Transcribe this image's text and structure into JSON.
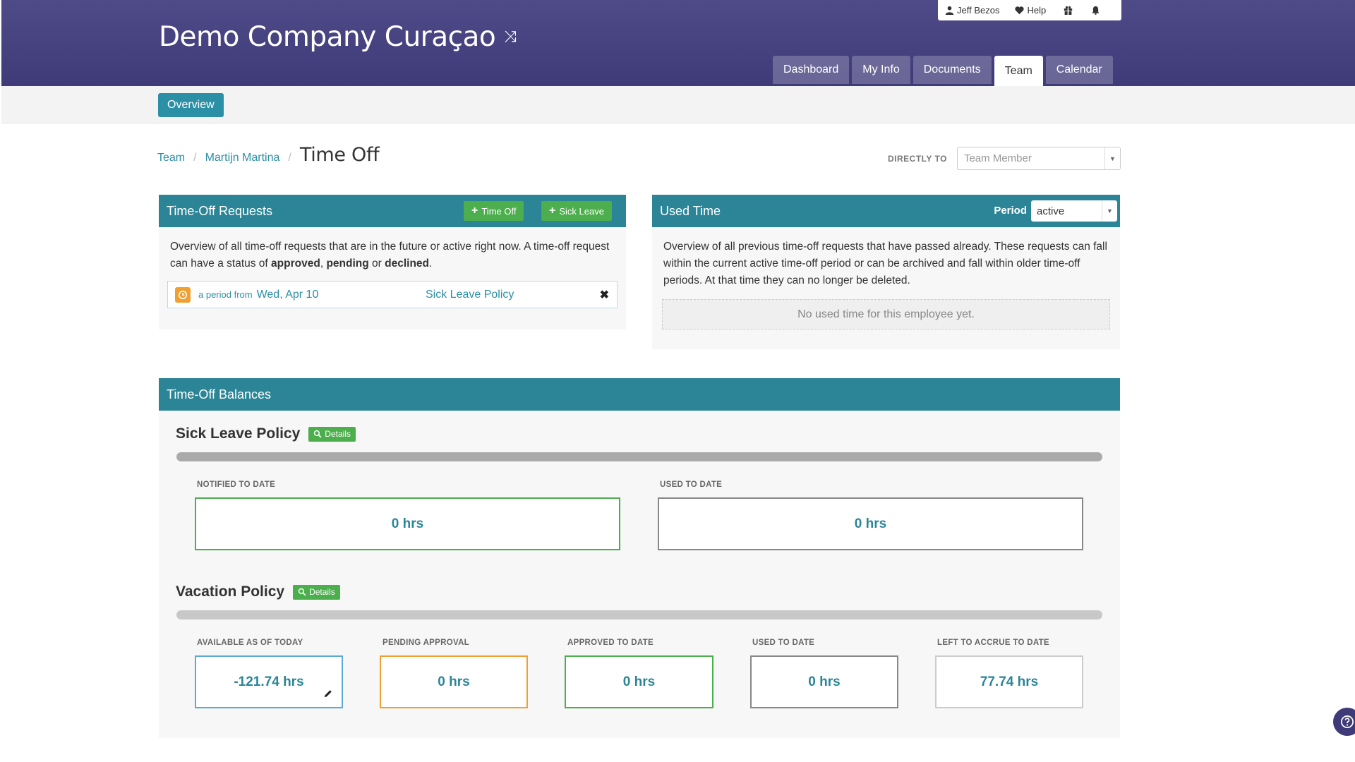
{
  "header": {
    "title": "Demo Company Curaçao",
    "user": "Jeff Bezos",
    "help": "Help",
    "nav": [
      "Dashboard",
      "My Info",
      "Documents",
      "Team",
      "Calendar"
    ],
    "active_tab": "Team"
  },
  "subnav": {
    "overview": "Overview"
  },
  "breadcrumb": {
    "team": "Team",
    "person": "Martijn Martina",
    "current": "Time Off"
  },
  "directly_to": {
    "label": "DIRECTLY TO",
    "placeholder": "Team Member"
  },
  "requests": {
    "title": "Time-Off Requests",
    "btn_time_off": "Time Off",
    "btn_sick_leave": "Sick Leave",
    "desc_1": "Overview of all time-off requests that are in the future or active right now. A time-off request can have a status of ",
    "approved": "approved",
    "comma": ", ",
    "pending": "pending",
    "or": " or ",
    "declined": "declined",
    "dot": ".",
    "row": {
      "period_prefix": "a period from",
      "date": "Wed, Apr 10",
      "policy": "Sick Leave Policy"
    }
  },
  "used_time": {
    "title": "Used Time",
    "period_label": "Period",
    "period_value": "active",
    "desc": "Overview of all previous time-off requests that have passed already. These requests can fall within the current active time-off period or can be archived and fall within older time-off periods. At that time they can no longer be deleted.",
    "empty": "No used time for this employee yet."
  },
  "balances": {
    "title": "Time-Off Balances",
    "details": "Details",
    "sick": {
      "name": "Sick Leave Policy",
      "stats": [
        {
          "label": "NOTIFIED TO DATE",
          "value": "0 hrs"
        },
        {
          "label": "USED TO DATE",
          "value": "0 hrs"
        }
      ]
    },
    "vacation": {
      "name": "Vacation Policy",
      "stats": [
        {
          "label": "AVAILABLE AS OF TODAY",
          "value": "-121.74 hrs"
        },
        {
          "label": "PENDING APPROVAL",
          "value": "0 hrs"
        },
        {
          "label": "APPROVED TO DATE",
          "value": "0 hrs"
        },
        {
          "label": "USED TO DATE",
          "value": "0 hrs"
        },
        {
          "label": "LEFT TO ACCRUE TO DATE",
          "value": "77.74 hrs"
        }
      ]
    }
  },
  "colors": {
    "brand": "#3f3a78",
    "teal": "#2b8596",
    "green": "#4cae4c",
    "orange": "#f0a030"
  }
}
